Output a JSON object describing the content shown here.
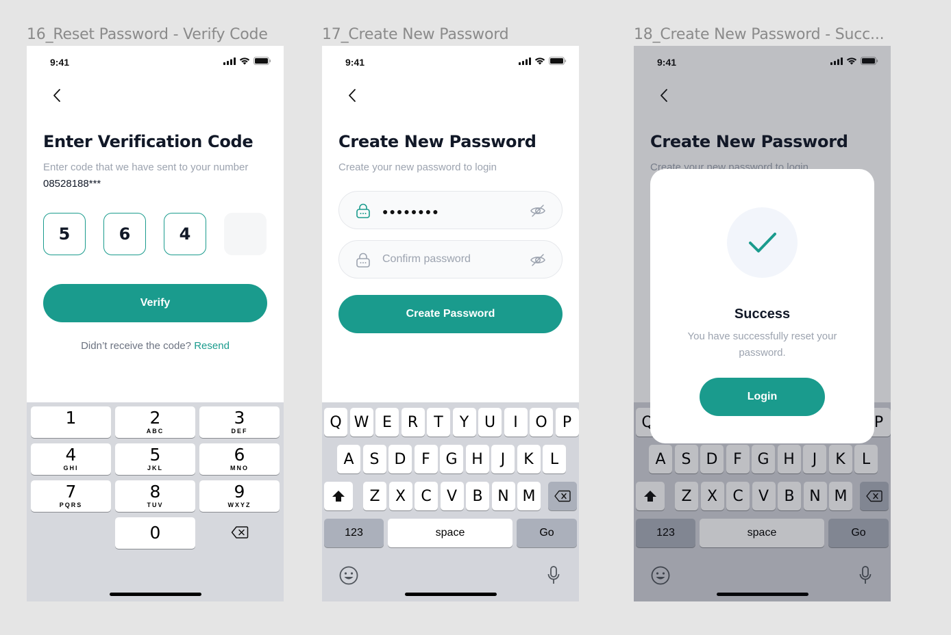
{
  "frames": [
    {
      "title": "16_Reset Password - Verify Code"
    },
    {
      "title": "17_Create New Password"
    },
    {
      "title": "18_Create New Password - Succ..."
    }
  ],
  "status": {
    "time": "9:41"
  },
  "verify": {
    "heading": "Enter Verification Code",
    "sub_text": "Enter code that we have sent to your number",
    "phone": "08528188***",
    "digits": [
      "5",
      "6",
      "4",
      ""
    ],
    "button": "Verify",
    "resend_prompt": "Didn’t receive the code?",
    "resend_link": "Resend",
    "numpad": [
      {
        "d": "1",
        "l": ""
      },
      {
        "d": "2",
        "l": "ABC"
      },
      {
        "d": "3",
        "l": "DEF"
      },
      {
        "d": "4",
        "l": "GHI"
      },
      {
        "d": "5",
        "l": "JKL"
      },
      {
        "d": "6",
        "l": "MNO"
      },
      {
        "d": "7",
        "l": "PQRS"
      },
      {
        "d": "8",
        "l": "TUV"
      },
      {
        "d": "9",
        "l": "WXYZ"
      },
      {
        "d": "0",
        "l": ""
      }
    ]
  },
  "create": {
    "heading": "Create New Password",
    "sub_text": "Create your new password to login",
    "password_value": "●●●●●●●●",
    "confirm_placeholder": "Confirm password",
    "button": "Create Password"
  },
  "keyboard": {
    "row1": [
      "Q",
      "W",
      "E",
      "R",
      "T",
      "Y",
      "U",
      "I",
      "O",
      "P"
    ],
    "row2": [
      "A",
      "S",
      "D",
      "F",
      "G",
      "H",
      "J",
      "K",
      "L"
    ],
    "row3": [
      "Z",
      "X",
      "C",
      "V",
      "B",
      "N",
      "M"
    ],
    "numbers_key": "123",
    "space_key": "space",
    "go_key": "Go"
  },
  "success": {
    "heading": "Create New Password",
    "sub_text": "Create your new password to login",
    "modal_title": "Success",
    "modal_text": "You have successfully reset your password.",
    "modal_button": "Login"
  },
  "colors": {
    "accent": "#1A9B8D",
    "text": "#111827",
    "muted": "#9CA3AF"
  }
}
